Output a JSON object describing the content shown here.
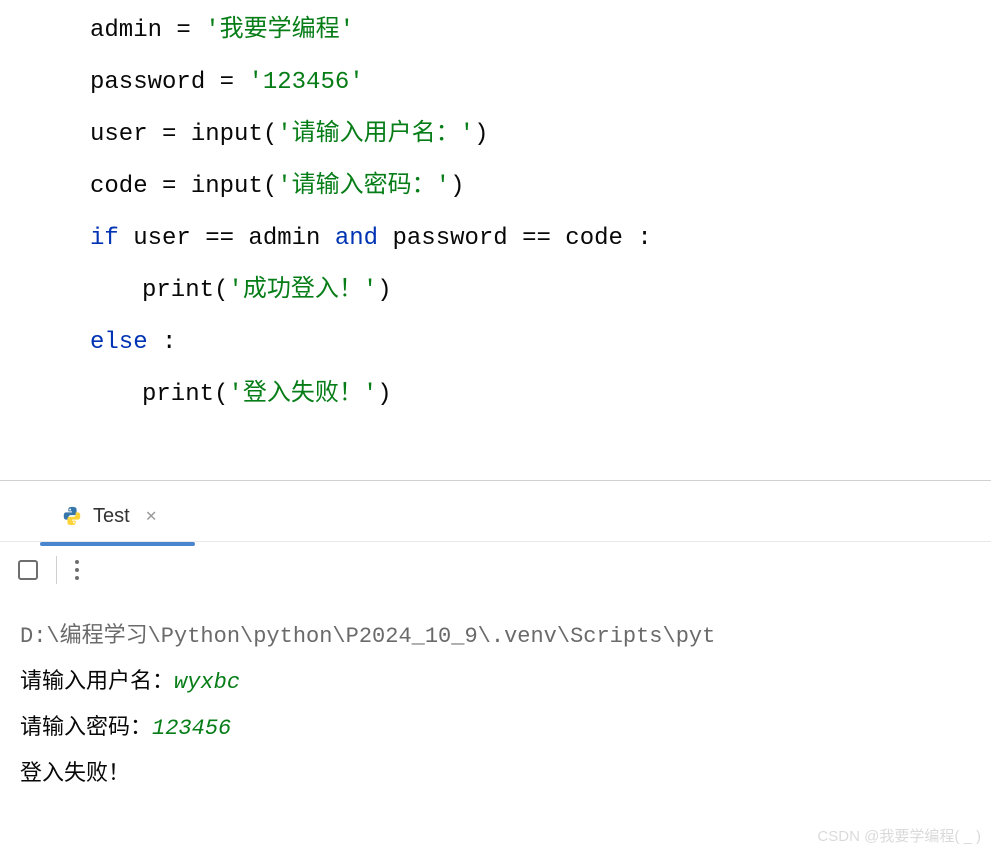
{
  "code": {
    "line1": {
      "var": "admin",
      "eq": " = ",
      "str": "'我要学编程'"
    },
    "line2": {
      "var": "password",
      "eq": " = ",
      "str": "'123456'"
    },
    "line3": {
      "var": "user",
      "eq": " = ",
      "fn": "input",
      "paren_open": "(",
      "str": "'请输入用户名：'",
      "paren_close": ")"
    },
    "line4": {
      "var": "code",
      "eq": " = ",
      "fn": "input",
      "paren_open": "(",
      "str": "'请输入密码：'",
      "paren_close": ")"
    },
    "line5": {
      "kw_if": "if",
      "expr1": " user == admin ",
      "kw_and": "and",
      "expr2": " password == code :"
    },
    "line6": {
      "fn": "print",
      "paren_open": "(",
      "str": "'成功登入！'",
      "paren_close": ")"
    },
    "line7": {
      "kw_else": "else",
      "colon": " :"
    },
    "line8": {
      "fn": "print",
      "paren_open": "(",
      "str": "'登入失败！'",
      "paren_close": ")"
    }
  },
  "tab": {
    "label": "Test"
  },
  "console": {
    "path": "D:\\编程学习\\Python\\python\\P2024_10_9\\.venv\\Scripts\\pyt",
    "prompt1": "请输入用户名：",
    "input1": "wyxbc",
    "prompt2": "请输入密码：",
    "input2": "123456",
    "output": "登入失败！"
  },
  "watermark": "CSDN @我要学编程( _ )"
}
